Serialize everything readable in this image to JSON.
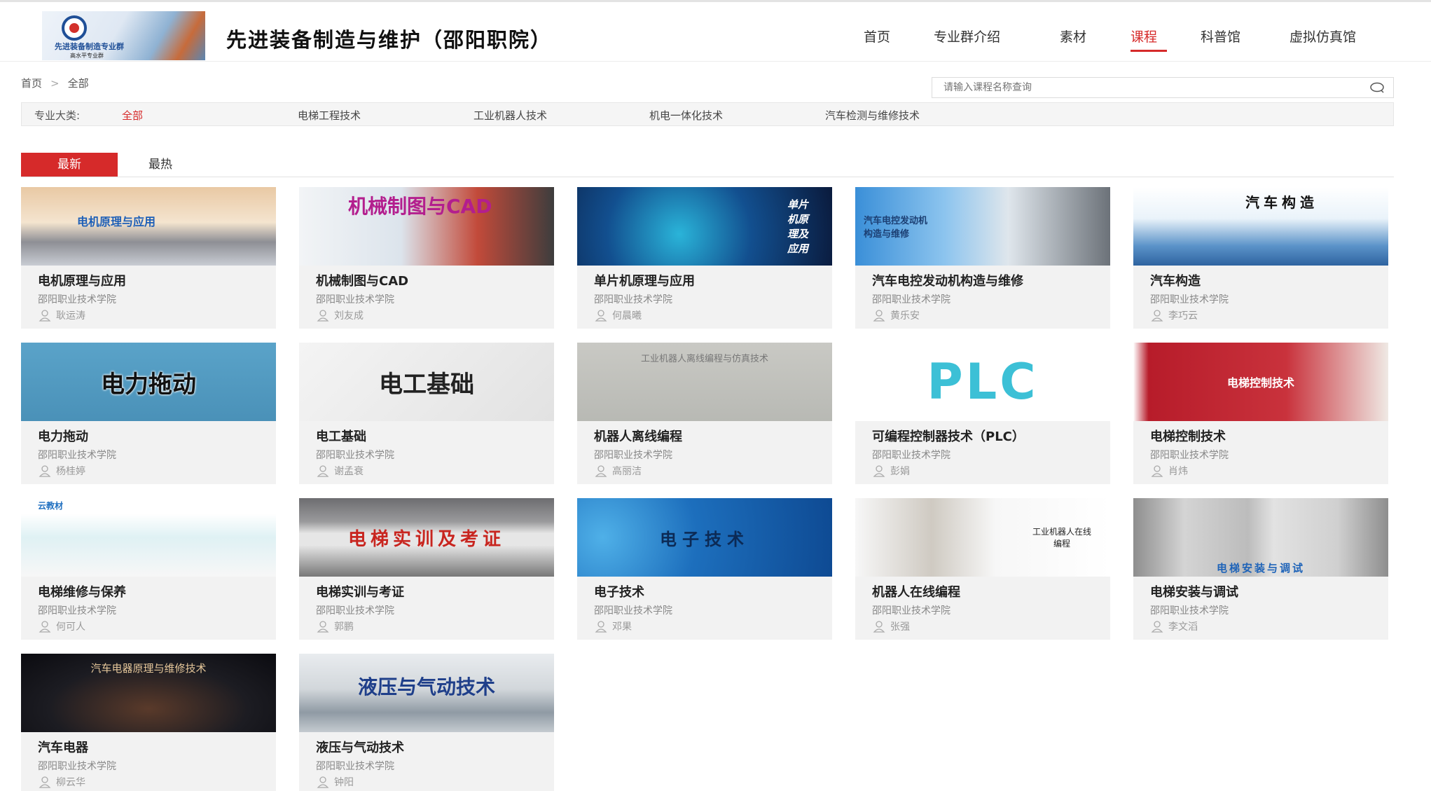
{
  "header": {
    "logo_text": "先进装备制造专业群",
    "logo_sub": "高水平专业群",
    "site_title": "先进装备制造与维护（邵阳职院）",
    "nav": [
      {
        "label": "首页",
        "active": false
      },
      {
        "label": "专业群介绍",
        "active": false
      },
      {
        "label": "素材",
        "active": false
      },
      {
        "label": "课程",
        "active": true
      },
      {
        "label": "科普馆",
        "active": false
      },
      {
        "label": "虚拟仿真馆",
        "active": false
      }
    ]
  },
  "breadcrumb": {
    "home": "首页",
    "separator": ">",
    "current": "全部"
  },
  "search": {
    "placeholder": "请输入课程名称查询",
    "icon": "search-icon"
  },
  "filter": {
    "label": "专业大类:",
    "items": [
      {
        "label": "全部",
        "active": true
      },
      {
        "label": "电梯工程技术",
        "active": false
      },
      {
        "label": "工业机器人技术",
        "active": false
      },
      {
        "label": "机电一体化技术",
        "active": false
      },
      {
        "label": "汽车检测与维修技术",
        "active": false
      }
    ]
  },
  "tabs": {
    "latest": "最新",
    "hot": "最热"
  },
  "colors": {
    "accent": "#d62a2a"
  },
  "courses": [
    {
      "title": "电机原理与应用",
      "school": "邵阳职业技术学院",
      "teacher": "耿运涛",
      "thumb_text": "电机原理与应用"
    },
    {
      "title": "机械制图与CAD",
      "school": "邵阳职业技术学院",
      "teacher": "刘友成",
      "thumb_text": "机械制图与CAD"
    },
    {
      "title": "单片机原理与应用",
      "school": "邵阳职业技术学院",
      "teacher": "何晨曦",
      "thumb_text": "单片机原理及应用"
    },
    {
      "title": "汽车电控发动机构造与维修",
      "school": "邵阳职业技术学院",
      "teacher": "黄乐安",
      "thumb_text": "汽车电控发动机构造与维修"
    },
    {
      "title": "汽车构造",
      "school": "邵阳职业技术学院",
      "teacher": "李巧云",
      "thumb_text": "汽车构造"
    },
    {
      "title": "电力拖动",
      "school": "邵阳职业技术学院",
      "teacher": "杨桂婷",
      "thumb_text": "电力拖动"
    },
    {
      "title": "电工基础",
      "school": "邵阳职业技术学院",
      "teacher": "谢孟衰",
      "thumb_text": "电工基础"
    },
    {
      "title": "机器人离线编程",
      "school": "邵阳职业技术学院",
      "teacher": "高丽洁",
      "thumb_text": "工业机器人离线编程与仿真技术"
    },
    {
      "title": "可编程控制器技术（PLC）",
      "school": "邵阳职业技术学院",
      "teacher": "彭娟",
      "thumb_text": "PLC"
    },
    {
      "title": "电梯控制技术",
      "school": "邵阳职业技术学院",
      "teacher": "肖炜",
      "thumb_text": "电梯控制技术"
    },
    {
      "title": "电梯维修与保养",
      "school": "邵阳职业技术学院",
      "teacher": "何可人",
      "thumb_text": "云教材"
    },
    {
      "title": "电梯实训与考证",
      "school": "邵阳职业技术学院",
      "teacher": "郭鹏",
      "thumb_text": "电梯实训及考证"
    },
    {
      "title": "电子技术",
      "school": "邵阳职业技术学院",
      "teacher": "邓果",
      "thumb_text": "电子技术"
    },
    {
      "title": "机器人在线编程",
      "school": "邵阳职业技术学院",
      "teacher": "张强",
      "thumb_text": "工业机器人在线编程"
    },
    {
      "title": "电梯安装与调试",
      "school": "邵阳职业技术学院",
      "teacher": "李文滔",
      "thumb_text": "电梯安装与调试"
    },
    {
      "title": "汽车电器",
      "school": "邵阳职业技术学院",
      "teacher": "柳云华",
      "thumb_text": "汽车电器原理与维修技术"
    },
    {
      "title": "液压与气动技术",
      "school": "邵阳职业技术学院",
      "teacher": "钟阳",
      "thumb_text": "液压与气动技术"
    }
  ]
}
